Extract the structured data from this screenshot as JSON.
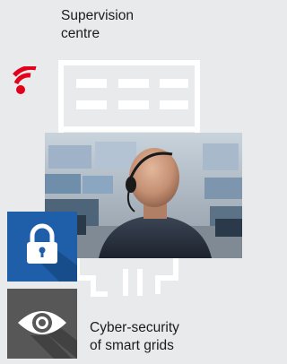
{
  "labels": {
    "supervision": "Supervision\ncentre",
    "cyber": "Cyber-security\nof smart grids"
  },
  "icons": {
    "signal": "wireless-signal-icon",
    "lock": "padlock-icon",
    "eye": "eye-icon"
  },
  "colors": {
    "background": "#e9eaeb",
    "signal_red": "#e2001a",
    "lock_tile": "#1f5fa9",
    "eye_tile": "#575757",
    "building_outline": "#ffffff"
  }
}
